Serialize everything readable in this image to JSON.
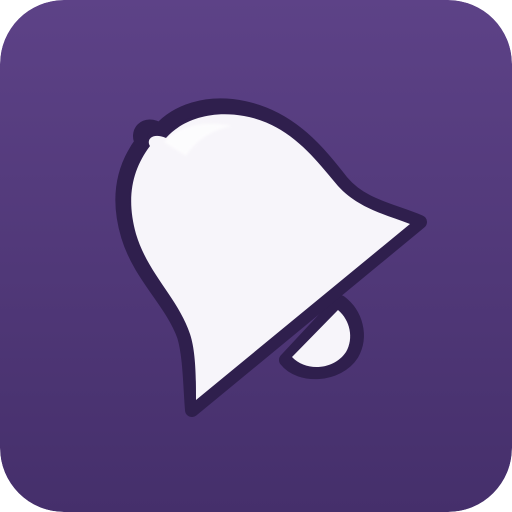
{
  "icon": {
    "name": "bell-icon",
    "colors": {
      "background_top": "#5d4287",
      "background_bottom": "#452f6b",
      "bell_fill": "#f7f5fa",
      "bell_outline": "#2f1f4d"
    }
  }
}
